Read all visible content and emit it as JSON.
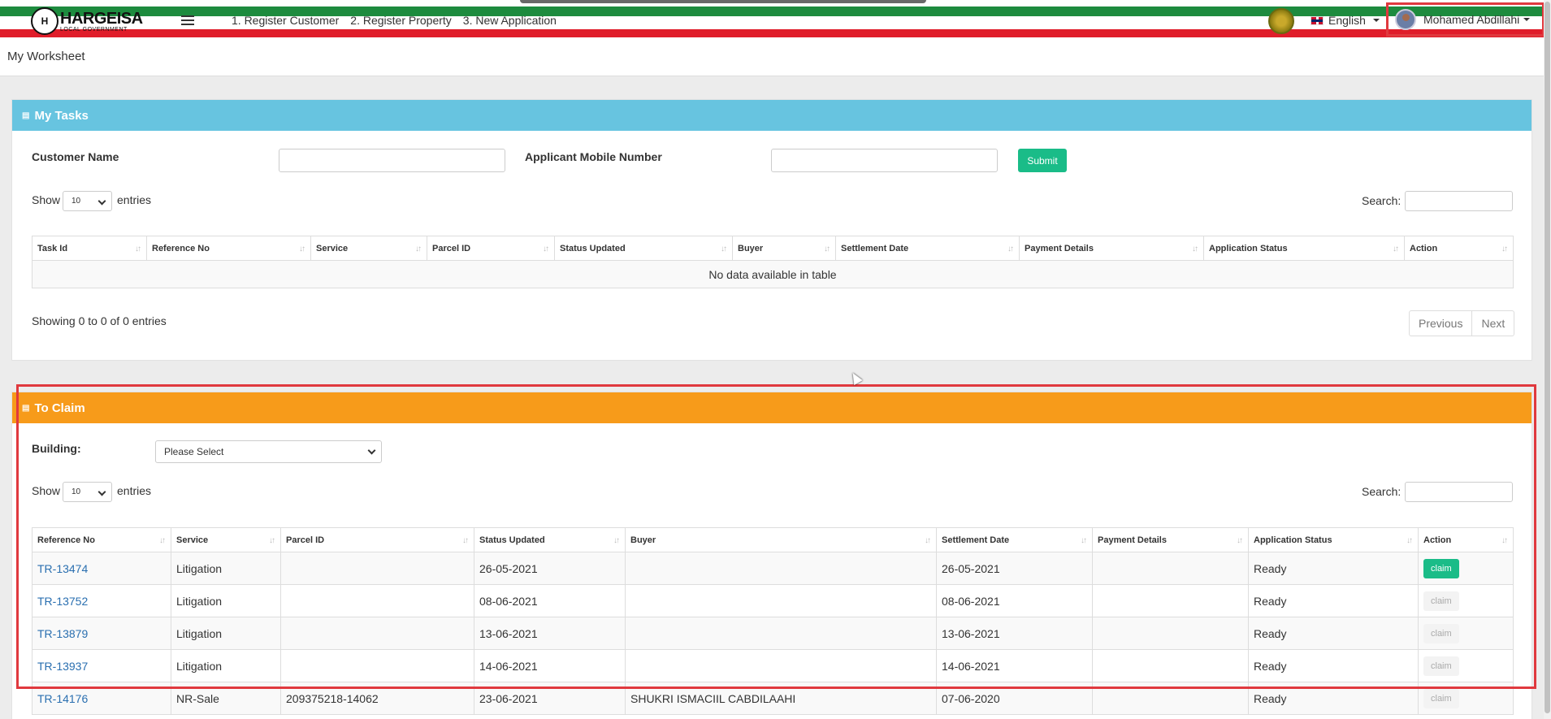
{
  "app": {
    "logo_title": "HARGEISA",
    "logo_subtitle": "LOCAL GOVERNMENT",
    "logo_mark": "H"
  },
  "topnav": {
    "items": [
      "1. Register Customer",
      "2. Register Property",
      "3. New Application"
    ]
  },
  "language": {
    "label": "English"
  },
  "user": {
    "name": "Mohamed Abdillahi"
  },
  "worksheet": {
    "title": "My Worksheet"
  },
  "my_tasks": {
    "title": "My Tasks",
    "customer_name_label": "Customer Name",
    "customer_name_value": "",
    "mobile_label": "Applicant Mobile Number",
    "mobile_value": "",
    "submit_label": "Submit",
    "show_label": "Show",
    "entries_value": "10",
    "entries_label": "entries",
    "search_label": "Search:",
    "columns": [
      "Task Id",
      "Reference No",
      "Service",
      "Parcel ID",
      "Status Updated",
      "Buyer",
      "Settlement Date",
      "Payment Details",
      "Application Status",
      "Action"
    ],
    "empty_text": "No data available in table",
    "info": "Showing 0 to 0 of 0 entries",
    "previous_label": "Previous",
    "next_label": "Next"
  },
  "to_claim": {
    "title": "To Claim",
    "building_label": "Building:",
    "building_value": "Please Select",
    "show_label": "Show",
    "entries_value": "10",
    "entries_label": "entries",
    "search_label": "Search:",
    "columns": [
      "Reference No",
      "Service",
      "Parcel ID",
      "Status Updated",
      "Buyer",
      "Settlement Date",
      "Payment Details",
      "Application Status",
      "Action"
    ],
    "rows": [
      {
        "ref": "TR-13474",
        "service": "Litigation",
        "parcel": "",
        "status_updated": "26-05-2021",
        "buyer": "",
        "settlement": "26-05-2021",
        "payment": "",
        "app_status": "Ready",
        "action": "claim",
        "active": true
      },
      {
        "ref": "TR-13752",
        "service": "Litigation",
        "parcel": "",
        "status_updated": "08-06-2021",
        "buyer": "",
        "settlement": "08-06-2021",
        "payment": "",
        "app_status": "Ready",
        "action": "claim",
        "active": false
      },
      {
        "ref": "TR-13879",
        "service": "Litigation",
        "parcel": "",
        "status_updated": "13-06-2021",
        "buyer": "",
        "settlement": "13-06-2021",
        "payment": "",
        "app_status": "Ready",
        "action": "claim",
        "active": false
      },
      {
        "ref": "TR-13937",
        "service": "Litigation",
        "parcel": "",
        "status_updated": "14-06-2021",
        "buyer": "",
        "settlement": "14-06-2021",
        "payment": "",
        "app_status": "Ready",
        "action": "claim",
        "active": false
      },
      {
        "ref": "TR-14176",
        "service": "NR-Sale",
        "parcel": "209375218-14062",
        "status_updated": "23-06-2021",
        "buyer": "SHUKRI ISMACIIL CABDILAAHI",
        "settlement": "07-06-2020",
        "payment": "",
        "app_status": "Ready",
        "action": "claim",
        "active": false
      }
    ]
  },
  "colors": {
    "tasks_header": "#67c4e0",
    "claim_header": "#f79b1a",
    "accent_green": "#1abc88",
    "link": "#2a6fb0",
    "highlight_outline": "#e0393e"
  }
}
